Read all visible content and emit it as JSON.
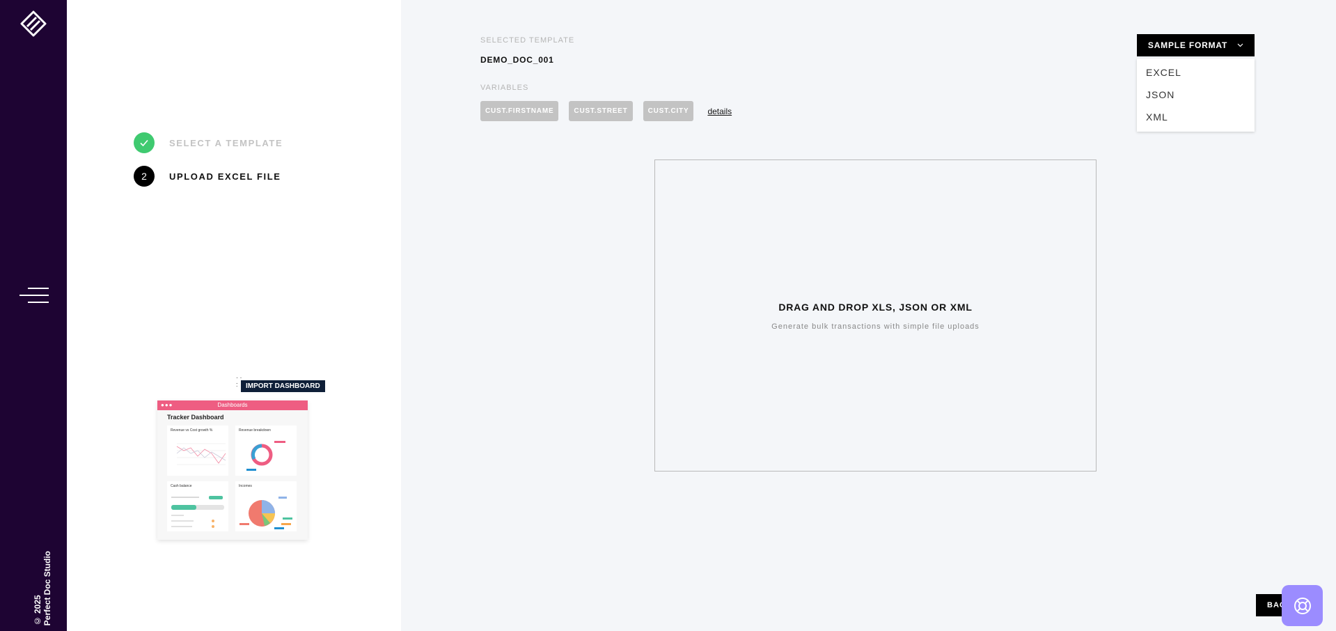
{
  "rail": {
    "logo_icon": "brand-logo-icon",
    "menu_icon": "hamburger-menu-icon",
    "copyright_line1": "© 2025",
    "copyright_line2": "Perfect Doc Studio"
  },
  "steps": [
    {
      "number": "✓",
      "label": "SELECT A TEMPLATE",
      "state": "done"
    },
    {
      "number": "2",
      "label": "UPLOAD EXCEL FILE",
      "state": "active"
    }
  ],
  "illustration": {
    "tag": "IMPORT DASHBOARD",
    "window_bar": "Dashboards",
    "title": "Tracker Dashboard",
    "panels": [
      "Revenue vs Cost growth %",
      "Revenue breakdown",
      "Cash balance",
      "Incomes"
    ]
  },
  "template": {
    "selected_label": "SELECTED TEMPLATE",
    "selected_value": "DEMO_DOC_001",
    "variables_label": "VARIABLES",
    "variables": [
      "CUST.FIRSTNAME",
      "CUST.STREET",
      "CUST.CITY"
    ],
    "details_link": "details"
  },
  "dropzone": {
    "title": "DRAG AND DROP XLS, JSON OR XML",
    "subtitle": "Generate bulk transactions with simple file uploads"
  },
  "sample_format": {
    "button_label": "SAMPLE FORMAT",
    "chevron_icon": "chevron-down-icon",
    "options": [
      "EXCEL",
      "JSON",
      "XML"
    ]
  },
  "footer": {
    "back_label": "BACK",
    "help_icon": "lifebuoy-icon"
  },
  "colors": {
    "rail_bg": "#1e0433",
    "step_done": "#3fca70",
    "accent_pink": "#ee5d82",
    "help_button": "#9b8cff"
  }
}
